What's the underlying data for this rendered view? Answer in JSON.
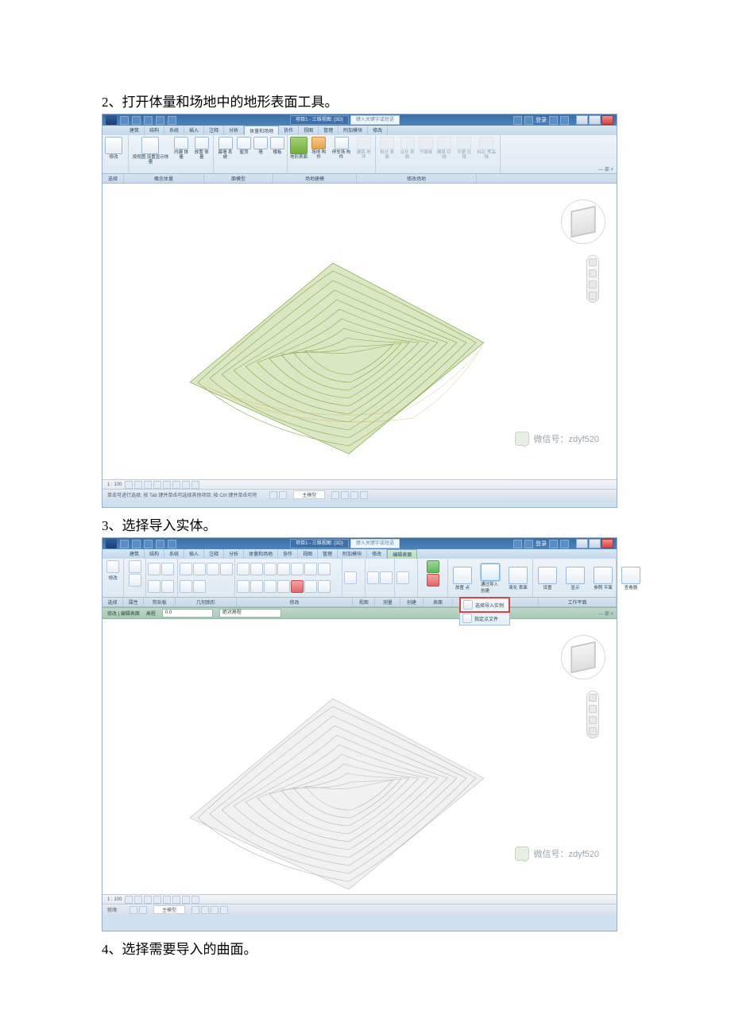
{
  "steps": {
    "s2": "2、打开体量和场地中的地形表面工具。",
    "s3": "3、选择导入实体。",
    "s4": "4、选择需要导入的曲面。"
  },
  "watermark": "微信号：zdyf520",
  "shot1": {
    "title_chip": "项目1 - 三维视图: {3D}",
    "title_hint": "键入关键字或短语",
    "login": "登录",
    "tabs": [
      "建筑",
      "结构",
      "系统",
      "插入",
      "注释",
      "分析",
      "体量和场地",
      "协作",
      "视图",
      "管理",
      "附加模块",
      "修改"
    ],
    "tabs_sel_index": 6,
    "panels": {
      "select": {
        "name": "选择",
        "items": [
          "修改"
        ]
      },
      "concept": {
        "name": "概念体量",
        "items": [
          "按视图\n设置显示体量",
          "内建\n体量",
          "放置\n体量"
        ]
      },
      "model": {
        "name": "面模型",
        "items": [
          "幕墙\n系统",
          "屋顶",
          "墙",
          "楼板"
        ]
      },
      "site": {
        "name": "场地建模",
        "items": [
          "地形表面",
          "场地\n构件",
          "停车场\n构件",
          "建筑\n地坪"
        ]
      },
      "modify": {
        "name": "修改场地",
        "items": [
          "拆分\n表面",
          "合并\n表面",
          "子面域",
          "建筑\n红线",
          "平整\n区域",
          "标记\n等高线"
        ]
      }
    },
    "status_scale": "1 : 100",
    "status_hint": "单击可进行选择; 按 Tab 键并单击可选择其他项目; 按 Ctrl 键并单击可将",
    "status_right": "主模型",
    "side_label": "— 部 ×"
  },
  "shot2": {
    "title_chip": "项目1 - 三维视图: {3D}",
    "title_hint": "键入关键字或短语",
    "login": "登录",
    "tabs": [
      "建筑",
      "结构",
      "系统",
      "插入",
      "注释",
      "分析",
      "体量和场地",
      "协作",
      "视图",
      "管理",
      "附加模块",
      "修改",
      "编辑表面"
    ],
    "tabs_sel_index": 12,
    "panel_names": [
      "选择",
      "属性",
      "剪贴板",
      "几何图形",
      "修改",
      "视图",
      "测量",
      "创建",
      "表面",
      "工具",
      "工作平面"
    ],
    "panel_widths": [
      26,
      26,
      40,
      78,
      150,
      28,
      32,
      28,
      38,
      110,
      60
    ],
    "big_buttons": {
      "place": "放置\n点",
      "import": "通过导入\n创建",
      "simplify": "简化\n表面",
      "set": "设置",
      "show": "显示",
      "ref": "参照\n平面",
      "viewer": "查看器"
    },
    "dropdown": {
      "item1": "选择导入实例",
      "item2": "指定点文件"
    },
    "subbar": {
      "lbl1": "修改 | 编辑表面",
      "lbl2": "高程",
      "val": "0.0",
      "lbl3": "绝对高程"
    },
    "status_scale": "1 : 100",
    "status_right": "主模型",
    "hint": "就绪",
    "side_label": "— 部 ×"
  }
}
